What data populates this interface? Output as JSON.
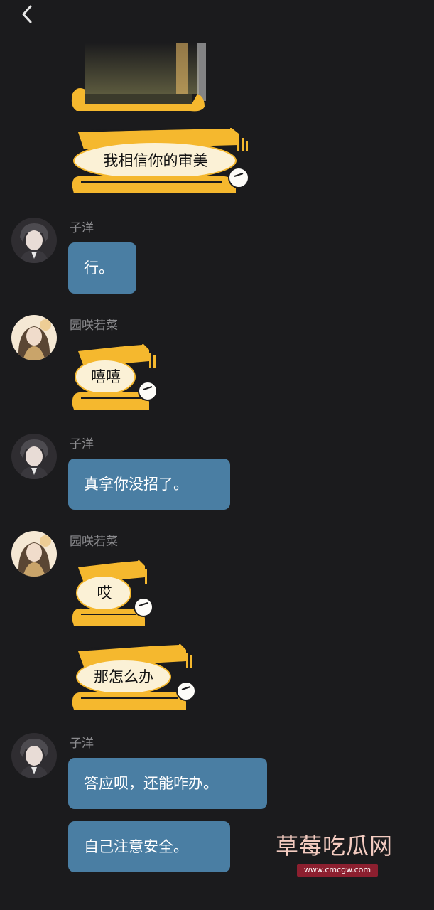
{
  "header": {
    "back_icon": "chevron-left-icon"
  },
  "messages": [
    {
      "type": "sticker",
      "text": "我相信你的审美"
    },
    {
      "type": "text",
      "sender": "子洋",
      "text": "行。"
    },
    {
      "type": "sticker",
      "sender": "园咲若菜",
      "text": "嘻嘻"
    },
    {
      "type": "text",
      "sender": "子洋",
      "text": "真拿你没招了。"
    },
    {
      "type": "sticker",
      "sender": "园咲若菜",
      "text": "哎"
    },
    {
      "type": "sticker",
      "text": "那怎么办"
    },
    {
      "type": "text",
      "sender": "子洋",
      "text": "答应呗，还能咋办。"
    },
    {
      "type": "text",
      "text": "自己注意安全。"
    }
  ],
  "watermark": {
    "title": "草莓吃瓜网",
    "url": "www.cmcgw.com"
  },
  "colors": {
    "background": "#1b1b1d",
    "bubble": "#4a7ea3",
    "sticker": "#f5b82e",
    "watermark": "#f3cbc0"
  }
}
